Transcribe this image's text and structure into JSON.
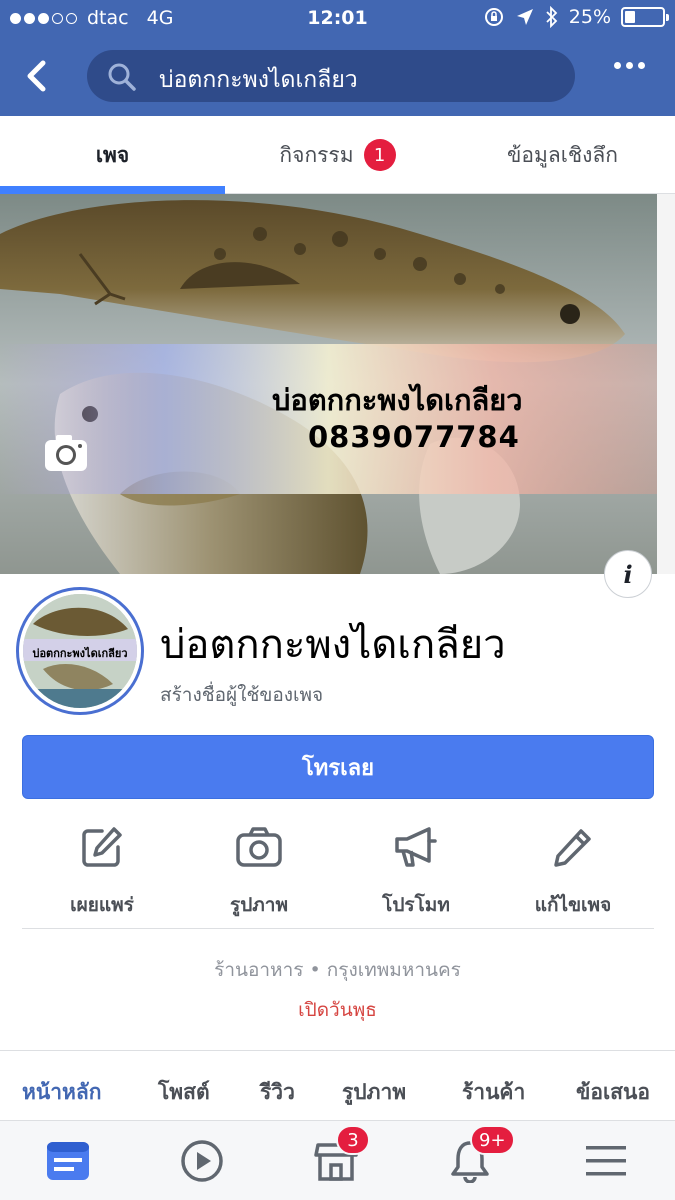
{
  "status_bar": {
    "carrier": "dtac",
    "network": "4G",
    "time": "12:01",
    "battery": "25%"
  },
  "header": {
    "search_text": "บ่อตกกะพงไดเกลียว"
  },
  "tabs": [
    {
      "label": "เพจ",
      "active": true
    },
    {
      "label": "กิจกรรม",
      "badge": "1"
    },
    {
      "label": "ข้อมูลเชิงลึก"
    }
  ],
  "cover": {
    "title": "บ่อตกกะพงไดเกลียว",
    "phone": "0839077784"
  },
  "profile": {
    "avatar_label": "บ่อตกกะพงไดเกลียว",
    "page_name": "บ่อตกกะพงไดเกลียว",
    "username_prompt": "สร้างชื่อผู้ใช้ของเพจ"
  },
  "call_button": {
    "label": "โทรเลย"
  },
  "actions": [
    {
      "label": "เผยแพร่",
      "icon": "edit-icon"
    },
    {
      "label": "รูปภาพ",
      "icon": "camera-icon"
    },
    {
      "label": "โปรโมท",
      "icon": "megaphone-icon"
    },
    {
      "label": "แก้ไขเพจ",
      "icon": "pencil-icon"
    }
  ],
  "info": {
    "category_location": "ร้านอาหาร • กรุงเทพมหานคร",
    "open_status": "เปิดวันพุธ"
  },
  "page_tabs": [
    {
      "label": "หน้าหลัก",
      "active": true
    },
    {
      "label": "โพสต์"
    },
    {
      "label": "รีวิว"
    },
    {
      "label": "รูปภาพ"
    },
    {
      "label": "ร้านค้า"
    },
    {
      "label": "ข้อเสนอ"
    }
  ],
  "bottom_nav": {
    "marketplace_badge": "3",
    "notifications_badge": "9+"
  },
  "colors": {
    "brand": "#4267b2",
    "accent": "#4080ff",
    "badge": "#e41e3f",
    "open_status": "#d64541"
  }
}
